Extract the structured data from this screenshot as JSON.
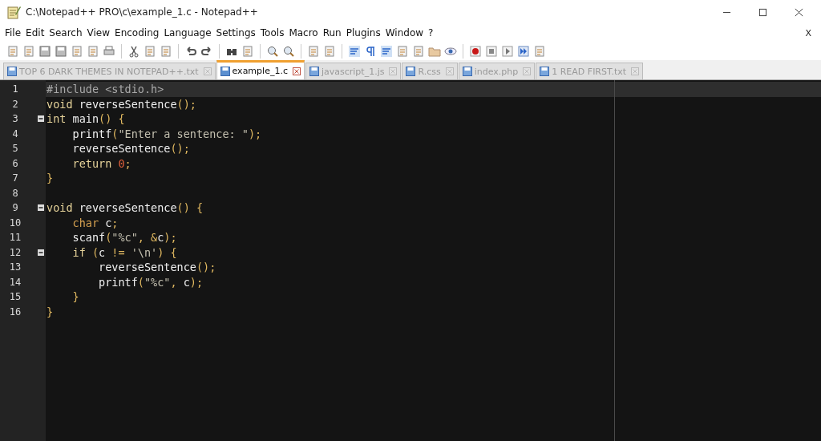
{
  "window": {
    "title": "C:\\Notepad++ PRO\\c\\example_1.c - Notepad++"
  },
  "menu": [
    "File",
    "Edit",
    "Search",
    "View",
    "Encoding",
    "Language",
    "Settings",
    "Tools",
    "Macro",
    "Run",
    "Plugins",
    "Window",
    "?"
  ],
  "menu_close": "X",
  "tabs": [
    {
      "label": "TOP 6 DARK THEMES IN NOTEPAD++.txt",
      "selected": false
    },
    {
      "label": "example_1.c",
      "selected": true
    },
    {
      "label": "javascript_1.js",
      "selected": false
    },
    {
      "label": "R.css",
      "selected": false
    },
    {
      "label": "index.php",
      "selected": false
    },
    {
      "label": "1 READ FIRST.txt",
      "selected": false
    }
  ],
  "editor": {
    "lines": [
      {
        "number": "1",
        "current": true,
        "fold": false,
        "tokens": [
          {
            "kind": "preproc",
            "text": "#include <stdio.h>"
          }
        ]
      },
      {
        "number": "2",
        "current": false,
        "fold": false,
        "tokens": [
          {
            "kind": "keyword",
            "text": "void"
          },
          {
            "kind": "plain",
            "text": " reverseSentence"
          },
          {
            "kind": "punct",
            "text": "();"
          }
        ]
      },
      {
        "number": "3",
        "current": false,
        "fold": true,
        "tokens": [
          {
            "kind": "keyword",
            "text": "int"
          },
          {
            "kind": "plain",
            "text": " main"
          },
          {
            "kind": "punct",
            "text": "() {"
          }
        ]
      },
      {
        "number": "4",
        "current": false,
        "fold": false,
        "tokens": [
          {
            "kind": "plain",
            "text": "    printf"
          },
          {
            "kind": "punct",
            "text": "("
          },
          {
            "kind": "string",
            "text": "\"Enter a sentence: \""
          },
          {
            "kind": "punct",
            "text": ");"
          }
        ]
      },
      {
        "number": "5",
        "current": false,
        "fold": false,
        "tokens": [
          {
            "kind": "plain",
            "text": "    reverseSentence"
          },
          {
            "kind": "punct",
            "text": "();"
          }
        ]
      },
      {
        "number": "6",
        "current": false,
        "fold": false,
        "tokens": [
          {
            "kind": "keyword",
            "text": "    return "
          },
          {
            "kind": "number",
            "text": "0"
          },
          {
            "kind": "punct",
            "text": ";"
          }
        ]
      },
      {
        "number": "7",
        "current": false,
        "fold": false,
        "tokens": [
          {
            "kind": "punct",
            "text": "}"
          }
        ]
      },
      {
        "number": "8",
        "current": false,
        "fold": false
      },
      {
        "number": "9",
        "current": false,
        "fold": true,
        "tokens": [
          {
            "kind": "keyword",
            "text": "void"
          },
          {
            "kind": "plain",
            "text": " reverseSentence"
          },
          {
            "kind": "punct",
            "text": "() {"
          }
        ]
      },
      {
        "number": "10",
        "current": false,
        "fold": false,
        "tokens": [
          {
            "kind": "type",
            "text": "    char"
          },
          {
            "kind": "plain",
            "text": " c"
          },
          {
            "kind": "punct",
            "text": ";"
          }
        ]
      },
      {
        "number": "11",
        "current": false,
        "fold": false,
        "tokens": [
          {
            "kind": "plain",
            "text": "    scanf"
          },
          {
            "kind": "punct",
            "text": "("
          },
          {
            "kind": "string",
            "text": "\"%c\""
          },
          {
            "kind": "punct",
            "text": ", &"
          },
          {
            "kind": "plain",
            "text": "c"
          },
          {
            "kind": "punct",
            "text": ");"
          }
        ]
      },
      {
        "number": "12",
        "current": false,
        "fold": true,
        "tokens": [
          {
            "kind": "keyword",
            "text": "    if"
          },
          {
            "kind": "punct",
            "text": " ("
          },
          {
            "kind": "plain",
            "text": "c"
          },
          {
            "kind": "punct",
            "text": " != "
          },
          {
            "kind": "string",
            "text": "'\\n'"
          },
          {
            "kind": "punct",
            "text": ") {"
          }
        ]
      },
      {
        "number": "13",
        "current": false,
        "fold": false,
        "tokens": [
          {
            "kind": "plain",
            "text": "        reverseSentence"
          },
          {
            "kind": "punct",
            "text": "();"
          }
        ]
      },
      {
        "number": "14",
        "current": false,
        "fold": false,
        "tokens": [
          {
            "kind": "plain",
            "text": "        printf"
          },
          {
            "kind": "punct",
            "text": "("
          },
          {
            "kind": "string",
            "text": "\"%c\""
          },
          {
            "kind": "punct",
            "text": ", "
          },
          {
            "kind": "plain",
            "text": "c"
          },
          {
            "kind": "punct",
            "text": ");"
          }
        ]
      },
      {
        "number": "15",
        "current": false,
        "fold": false,
        "tokens": [
          {
            "kind": "punct",
            "text": "    }"
          }
        ]
      },
      {
        "number": "16",
        "current": false,
        "fold": false,
        "tokens": [
          {
            "kind": "punct",
            "text": "}"
          }
        ]
      }
    ]
  }
}
